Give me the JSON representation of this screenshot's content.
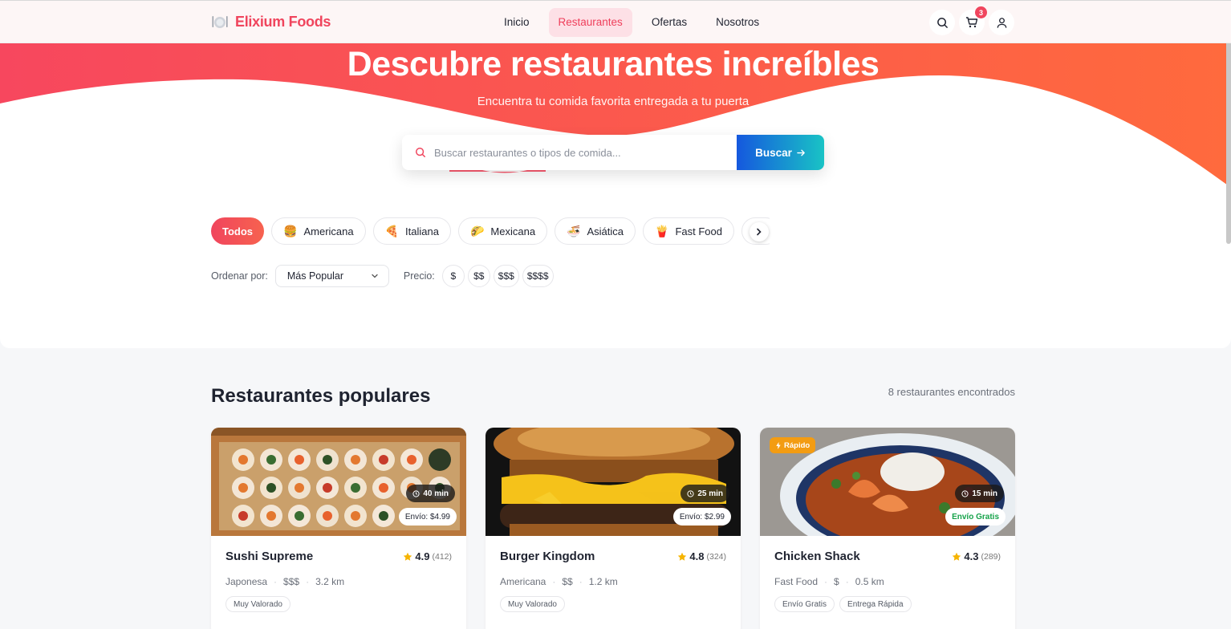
{
  "nav": {
    "brand": "Elixium Foods",
    "links": [
      "Inicio",
      "Restaurantes",
      "Ofertas",
      "Nosotros"
    ],
    "active_link": "Restaurantes",
    "cart_count": "3"
  },
  "hero": {
    "title": "Descubre restaurantes increíbles",
    "subtitle": "Encuentra tu comida favorita entregada a tu puerta",
    "search_placeholder": "Buscar restaurantes o tipos de comida...",
    "search_button": "Buscar",
    "gradient_colors": [
      "#f7475e",
      "#ff6a3d"
    ]
  },
  "categories": [
    {
      "label": "Todos",
      "icon": "",
      "active": true
    },
    {
      "label": "Americana",
      "icon": "🍔"
    },
    {
      "label": "Italiana",
      "icon": "🍕"
    },
    {
      "label": "Mexicana",
      "icon": "🌮"
    },
    {
      "label": "Asiática",
      "icon": "🍜"
    },
    {
      "label": "Fast Food",
      "icon": "🍟"
    },
    {
      "label": "",
      "icon": "🥗"
    }
  ],
  "filters": {
    "sort_label": "Ordenar por:",
    "sort_value": "Más Popular",
    "price_label": "Precio:",
    "price_options": [
      "$",
      "$$",
      "$$$",
      "$$$$"
    ]
  },
  "listing": {
    "title": "Restaurantes populares",
    "count_text": "8 restaurantes encontrados",
    "restaurants": [
      {
        "name": "Sushi Supreme",
        "rating": "4.9",
        "reviews": "(412)",
        "cuisine": "Japonesa",
        "price": "$$$",
        "distance": "3.2 km",
        "time": "40 min",
        "shipping": "Envío: $4.99",
        "tags": [
          "Muy Valorado"
        ]
      },
      {
        "name": "Burger Kingdom",
        "rating": "4.8",
        "reviews": "(324)",
        "cuisine": "Americana",
        "price": "$$",
        "distance": "1.2 km",
        "time": "25 min",
        "shipping": "Envío: $2.99",
        "tags": [
          "Muy Valorado"
        ]
      },
      {
        "name": "Chicken Shack",
        "rating": "4.3",
        "reviews": "(289)",
        "cuisine": "Fast Food",
        "price": "$",
        "distance": "0.5 km",
        "time": "15 min",
        "shipping": "Envío Gratis",
        "badge": "Rápido",
        "tags": [
          "Envío Gratis",
          "Entrega Rápida"
        ]
      }
    ]
  }
}
